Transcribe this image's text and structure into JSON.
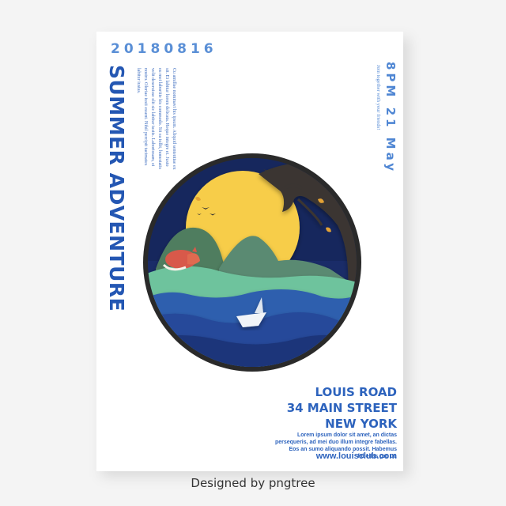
{
  "poster": {
    "date": "20180816",
    "title": "SUMMER ADVENTURE",
    "left_small_text": "Cu amillae nominavi his ipsum. Aliquid sententiae ex sit. Ei labitur lorem delicata. Reque integre ei. Justo eu mei laboritie his commodo. Sit ea tollit, honestatis velit deseruisse elit sic labitur iustis. Laboriosam, ei nostro. Oloriae iusti essent. Nihil percipit tacimates labitur iustas.",
    "time": "8PM 21 May",
    "right_small_text": "Join together with your friends!",
    "address_line1": "LOUIS ROAD",
    "address_line2": "34 MAIN STREET",
    "address_line3": "NEW YORK",
    "body_text": "Lorem ipsum dolor sit amet, an dictas persequeris, ad mei duo illum integre fabellas. Eos an sumo aliquando possit. Habemus fabellas pro ut.",
    "website": "www.louisclub.com"
  },
  "credit": "Designed by pngtree",
  "colors": {
    "accent": "#2457b3",
    "light_accent": "#5a8fd6",
    "moon": "#f7cd48",
    "night": "#1b2f68"
  },
  "illustration": {
    "icons": [
      "moon-icon",
      "tree-icon",
      "bird-icon",
      "fox-icon",
      "paper-boat-icon",
      "mountain-icon",
      "wave-icon"
    ]
  }
}
